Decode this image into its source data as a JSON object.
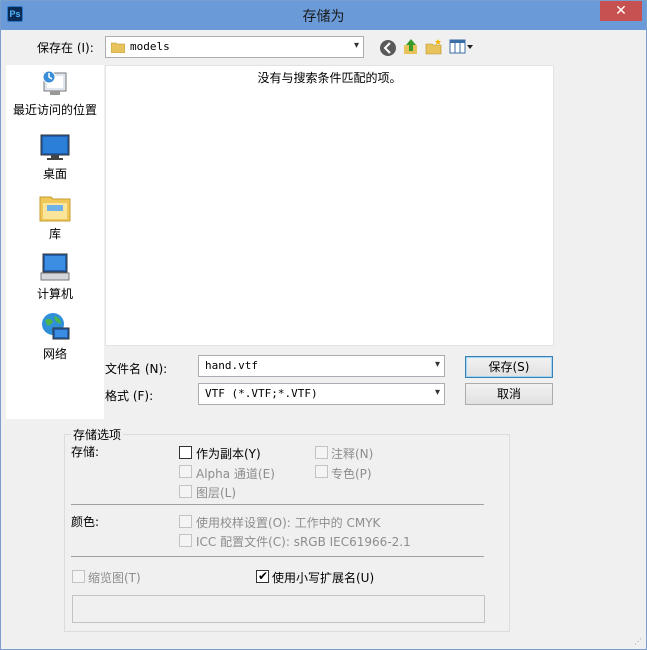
{
  "window": {
    "title": "存储为",
    "app_icon": "Ps",
    "close_glyph": "✕"
  },
  "location": {
    "label": "保存在 (I):",
    "value": "models"
  },
  "toolbar": {
    "icons": [
      "back-icon",
      "up-folder-icon",
      "new-folder-icon",
      "view-menu-icon"
    ]
  },
  "places": [
    {
      "label": "最近访问的位置",
      "icon": "recent-places-icon"
    },
    {
      "label": "桌面",
      "icon": "desktop-icon"
    },
    {
      "label": "库",
      "icon": "libraries-icon"
    },
    {
      "label": "计算机",
      "icon": "computer-icon"
    },
    {
      "label": "网络",
      "icon": "network-icon"
    }
  ],
  "file_list": {
    "empty_message": "没有与搜索条件匹配的项。"
  },
  "filename": {
    "label": "文件名 (N):",
    "value": "hand.vtf"
  },
  "format": {
    "label": "格式 (F):",
    "value": "VTF (*.VTF;*.VTF)"
  },
  "buttons": {
    "save": "保存(S)",
    "cancel": "取消"
  },
  "options": {
    "group_title": "存储选项",
    "save_label": "存储:",
    "as_copy": "作为副本(Y)",
    "notes": "注释(N)",
    "alpha": "Alpha 通道(E)",
    "spot": "专色(P)",
    "layers": "图层(L)",
    "color_label": "颜色:",
    "proof": "使用校样设置(O): 工作中的 CMYK",
    "icc": "ICC 配置文件(C): sRGB IEC61966-2.1",
    "thumbnail": "缩览图(T)",
    "lowercase": "使用小写扩展名(U)",
    "as_copy_checked": false,
    "lowercase_checked": true
  },
  "colors": {
    "titlebar": "#6a9ad8",
    "close": "#c75050",
    "dialog_bg": "#f0f0f0"
  }
}
